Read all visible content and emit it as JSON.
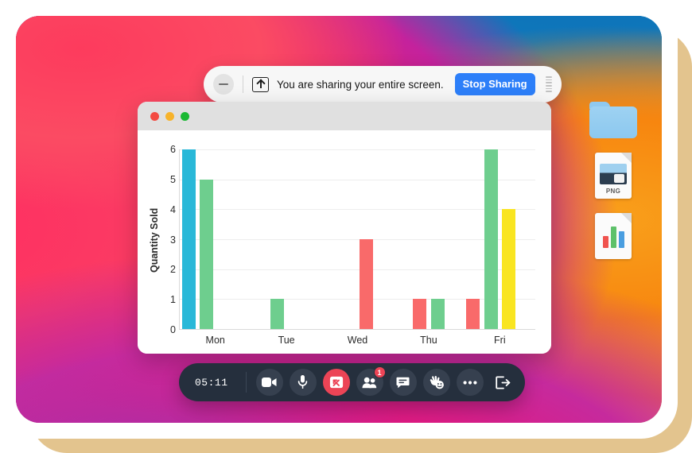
{
  "screen": {
    "wallpaper_colors": {
      "blue": "#127bbf",
      "orange": "#f9a01b",
      "pink": "#f7305e",
      "magenta": "#e2187f",
      "purple": "#9c36b4"
    },
    "frame_shadow_color": "#e3c48e"
  },
  "desktop_icons": [
    {
      "name": "folder",
      "label": "",
      "type": "folder"
    },
    {
      "name": "png-file",
      "label": "PNG",
      "type": "image-file"
    },
    {
      "name": "chart-file",
      "label": "",
      "type": "chart-file"
    }
  ],
  "share_bar": {
    "minimize_label": "",
    "share_icon": "screen-share-icon",
    "message": "You are sharing your entire screen.",
    "stop_label": "Stop Sharing",
    "stop_color": "#2d7ff9",
    "grip_icon": "drag-handle-icon"
  },
  "app_window": {
    "traffic_lights": [
      {
        "name": "close",
        "color": "#f34b42"
      },
      {
        "name": "minimize",
        "color": "#f7b32b"
      },
      {
        "name": "zoom",
        "color": "#1bb934"
      }
    ]
  },
  "meeting_bar": {
    "timer": "05:11",
    "controls": [
      {
        "name": "camera",
        "icon": "video-camera-icon",
        "style": "normal",
        "badge": null
      },
      {
        "name": "microphone",
        "icon": "microphone-icon",
        "style": "normal",
        "badge": null
      },
      {
        "name": "stop-share",
        "icon": "stop-screenshare-icon",
        "style": "danger",
        "badge": null
      },
      {
        "name": "participants",
        "icon": "people-icon",
        "style": "normal",
        "badge": "1"
      },
      {
        "name": "chat",
        "icon": "chat-bubble-icon",
        "style": "normal",
        "badge": null
      },
      {
        "name": "reactions",
        "icon": "raise-hand-emoji-icon",
        "style": "normal",
        "badge": null
      },
      {
        "name": "more",
        "icon": "ellipsis-icon",
        "style": "normal",
        "badge": null
      },
      {
        "name": "leave",
        "icon": "exit-arrow-icon",
        "style": "normal",
        "badge": null
      }
    ],
    "badge_color": "#ec4456",
    "bar_color": "#252f3d"
  },
  "chart_data": {
    "type": "bar",
    "title": "",
    "xlabel": "",
    "ylabel": "Quantity Sold",
    "categories": [
      "Mon",
      "Tue",
      "Wed",
      "Thu",
      "Fri"
    ],
    "ylim": [
      0,
      6
    ],
    "yticks": [
      0,
      1,
      2,
      3,
      4,
      5,
      6
    ],
    "grid": true,
    "legend": "none",
    "series": [
      {
        "name": "series-1",
        "color": "#29b8d8",
        "values": [
          6,
          0,
          0,
          0,
          0
        ]
      },
      {
        "name": "series-2",
        "color": "#6ece8e",
        "values": [
          5,
          1,
          0,
          1,
          6
        ]
      },
      {
        "name": "series-3",
        "color": "#f96a6a",
        "values": [
          0,
          0,
          3,
          1,
          1
        ]
      },
      {
        "name": "series-4",
        "color": "#f9e521",
        "values": [
          0,
          0,
          0,
          0,
          4
        ]
      }
    ],
    "bars": [
      {
        "category": "Mon",
        "slot": 0,
        "value": 6,
        "color": "#29b8d8"
      },
      {
        "category": "Mon",
        "slot": 1,
        "value": 5,
        "color": "#6ece8e"
      },
      {
        "category": "Tue",
        "slot": 1,
        "value": 1,
        "color": "#6ece8e"
      },
      {
        "category": "Wed",
        "slot": 2,
        "value": 3,
        "color": "#f96a6a"
      },
      {
        "category": "Thu",
        "slot": 1,
        "value": 1,
        "color": "#f96a6a"
      },
      {
        "category": "Thu",
        "slot": 2,
        "value": 1,
        "color": "#6ece8e"
      },
      {
        "category": "Fri",
        "slot": 0,
        "value": 1,
        "color": "#f96a6a"
      },
      {
        "category": "Fri",
        "slot": 1,
        "value": 6,
        "color": "#6ece8e"
      },
      {
        "category": "Fri",
        "slot": 2,
        "value": 4,
        "color": "#f9e521"
      }
    ]
  }
}
